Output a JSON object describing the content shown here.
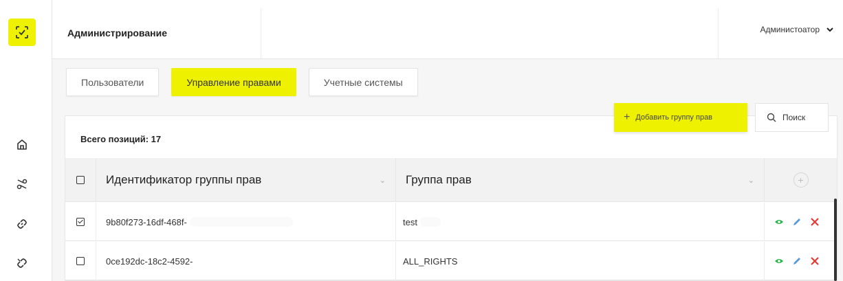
{
  "app": {
    "title": "Администрирование",
    "user_name": "Администоатор"
  },
  "colors": {
    "accent": "#eef200",
    "view_icon": "#2bb34a",
    "edit_icon": "#5b9bd5",
    "delete_icon": "#e53935"
  },
  "sidebar": {
    "logo_icon": "check-frame-icon",
    "items": [
      {
        "icon": "home-icon"
      },
      {
        "icon": "scissors-icon"
      },
      {
        "icon": "link-icon"
      },
      {
        "icon": "broken-link-icon"
      }
    ]
  },
  "tabs": [
    {
      "label": "Пользователи",
      "active": false
    },
    {
      "label": "Управление правами",
      "active": true
    },
    {
      "label": "Учетные системы",
      "active": false
    }
  ],
  "toolbar": {
    "add_label": "Добавить группу прав",
    "search_label": "Поиск"
  },
  "table": {
    "total_label": "Всего позиций: 17",
    "columns": [
      "Идентификатор группы прав",
      "Группа прав"
    ],
    "rows": [
      {
        "id": "9b80f273-16df-468f-",
        "group": "test",
        "checked": true
      },
      {
        "id": "0ce192dc-18c2-4592-",
        "group": "ALL_RIGHTS",
        "checked": false
      }
    ]
  }
}
